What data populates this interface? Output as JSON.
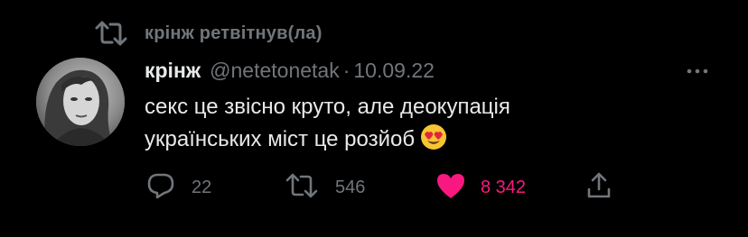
{
  "retweet_banner": {
    "icon": "retweet-icon",
    "label": "крінж ретвітнув(ла)"
  },
  "author": {
    "display_name": "крінж",
    "handle": "@netetonetak",
    "separator": "·",
    "date": "10.09.22",
    "avatar": "avatar-portrait"
  },
  "tweet": {
    "line1": "секс це звісно круто, але деокупація",
    "line2": "українських міст це розйоб",
    "emoji": "smiling-face-with-heart-eyes-emoji"
  },
  "actions": {
    "reply": {
      "icon": "reply-icon",
      "count": "22"
    },
    "retweet": {
      "icon": "retweet-icon",
      "count": "546"
    },
    "like": {
      "icon": "heart-icon",
      "count": "8 342",
      "liked": true
    },
    "share": {
      "icon": "share-icon"
    }
  },
  "more": {
    "icon": "more-horizontal-icon"
  },
  "colors": {
    "background": "#000000",
    "text_primary": "#e7e9ea",
    "text_secondary": "#71767b",
    "like_active": "#f91880"
  }
}
